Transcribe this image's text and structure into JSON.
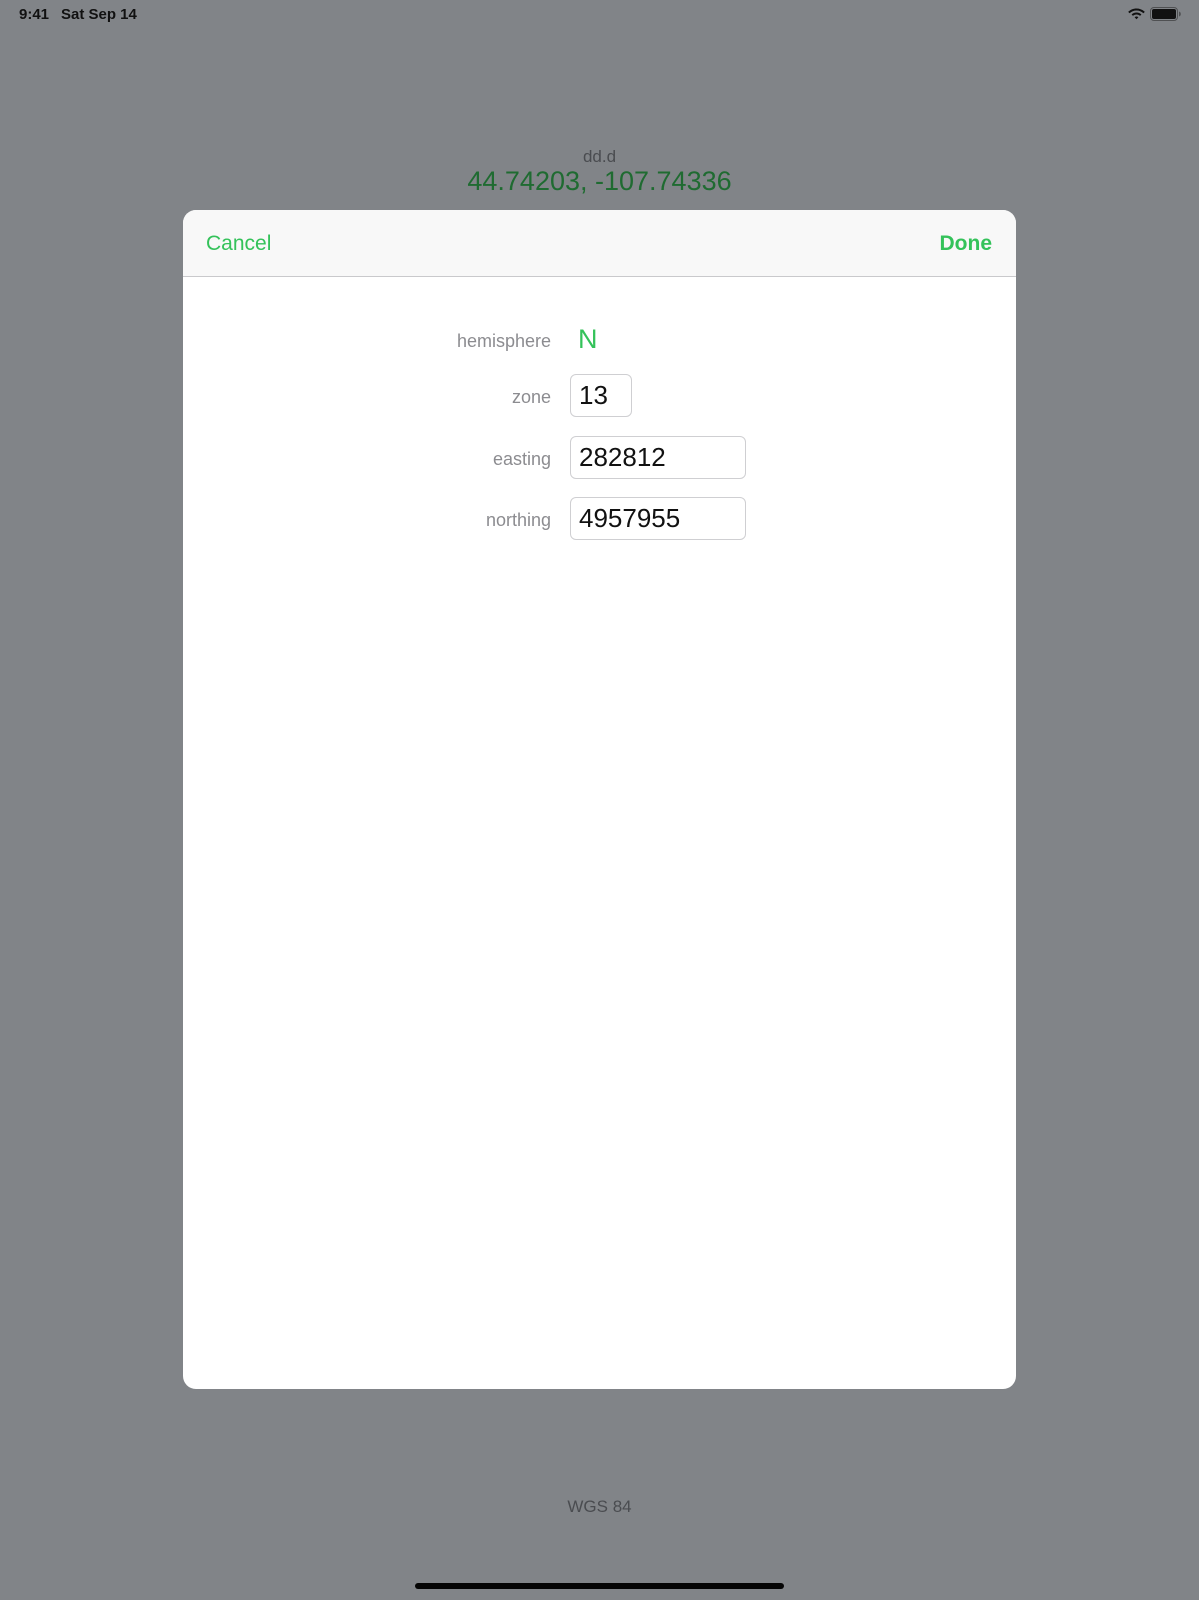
{
  "status_bar": {
    "time": "9:41",
    "date": "Sat Sep 14",
    "icons": [
      "wifi-icon",
      "battery-icon"
    ]
  },
  "background": {
    "format_label": "dd.d",
    "coordinates": "44.74203, -107.74336",
    "datum": "WGS 84"
  },
  "modal": {
    "nav": {
      "cancel_label": "Cancel",
      "done_label": "Done"
    },
    "fields": {
      "hemisphere": {
        "label": "hemisphere",
        "value": "N"
      },
      "zone": {
        "label": "zone",
        "value": "13"
      },
      "easting": {
        "label": "easting",
        "value": "282812"
      },
      "northing": {
        "label": "northing",
        "value": "4957955"
      }
    }
  },
  "colors": {
    "accent": "#34c25a",
    "coords_text": "#1f6b31",
    "dimmed_background": "#818488"
  }
}
